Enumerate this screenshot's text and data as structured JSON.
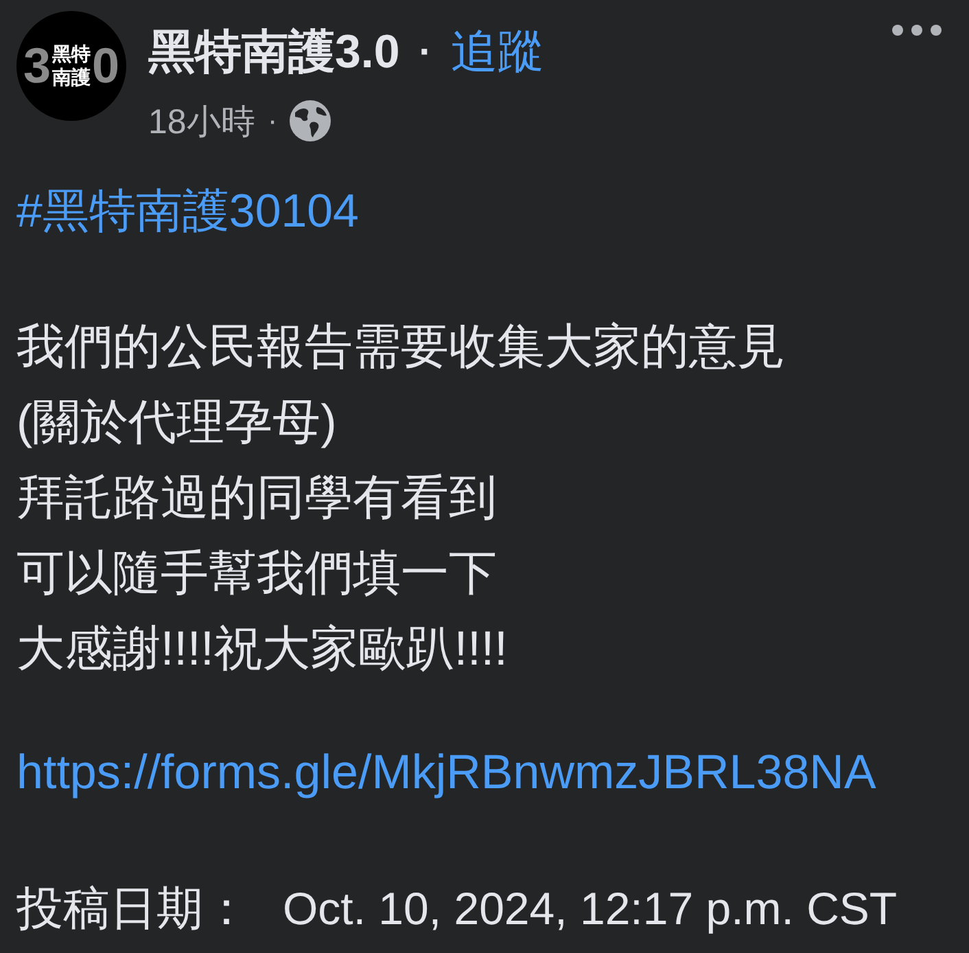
{
  "post": {
    "avatar": {
      "digits": [
        "3",
        "0"
      ],
      "lines": [
        "黑特",
        "南護"
      ]
    },
    "author": "黑特南護3.0",
    "name_separator": "·",
    "follow": "追蹤",
    "time": "18小時",
    "time_separator": "·",
    "hashtag": "#黑特南護30104",
    "lines": [
      "我們的公民報告需要收集大家的意見",
      "(關於代理孕母)",
      "拜託路過的同學有看到",
      "可以隨手幫我們填一下",
      "大感謝!!!!祝大家歐趴!!!!"
    ],
    "link": "https://forms.gle/MkjRBnwmzJBRL38NA",
    "date_label": "投稿日期：",
    "date_value": "Oct. 10, 2024, 12:17 p.m. CST"
  }
}
